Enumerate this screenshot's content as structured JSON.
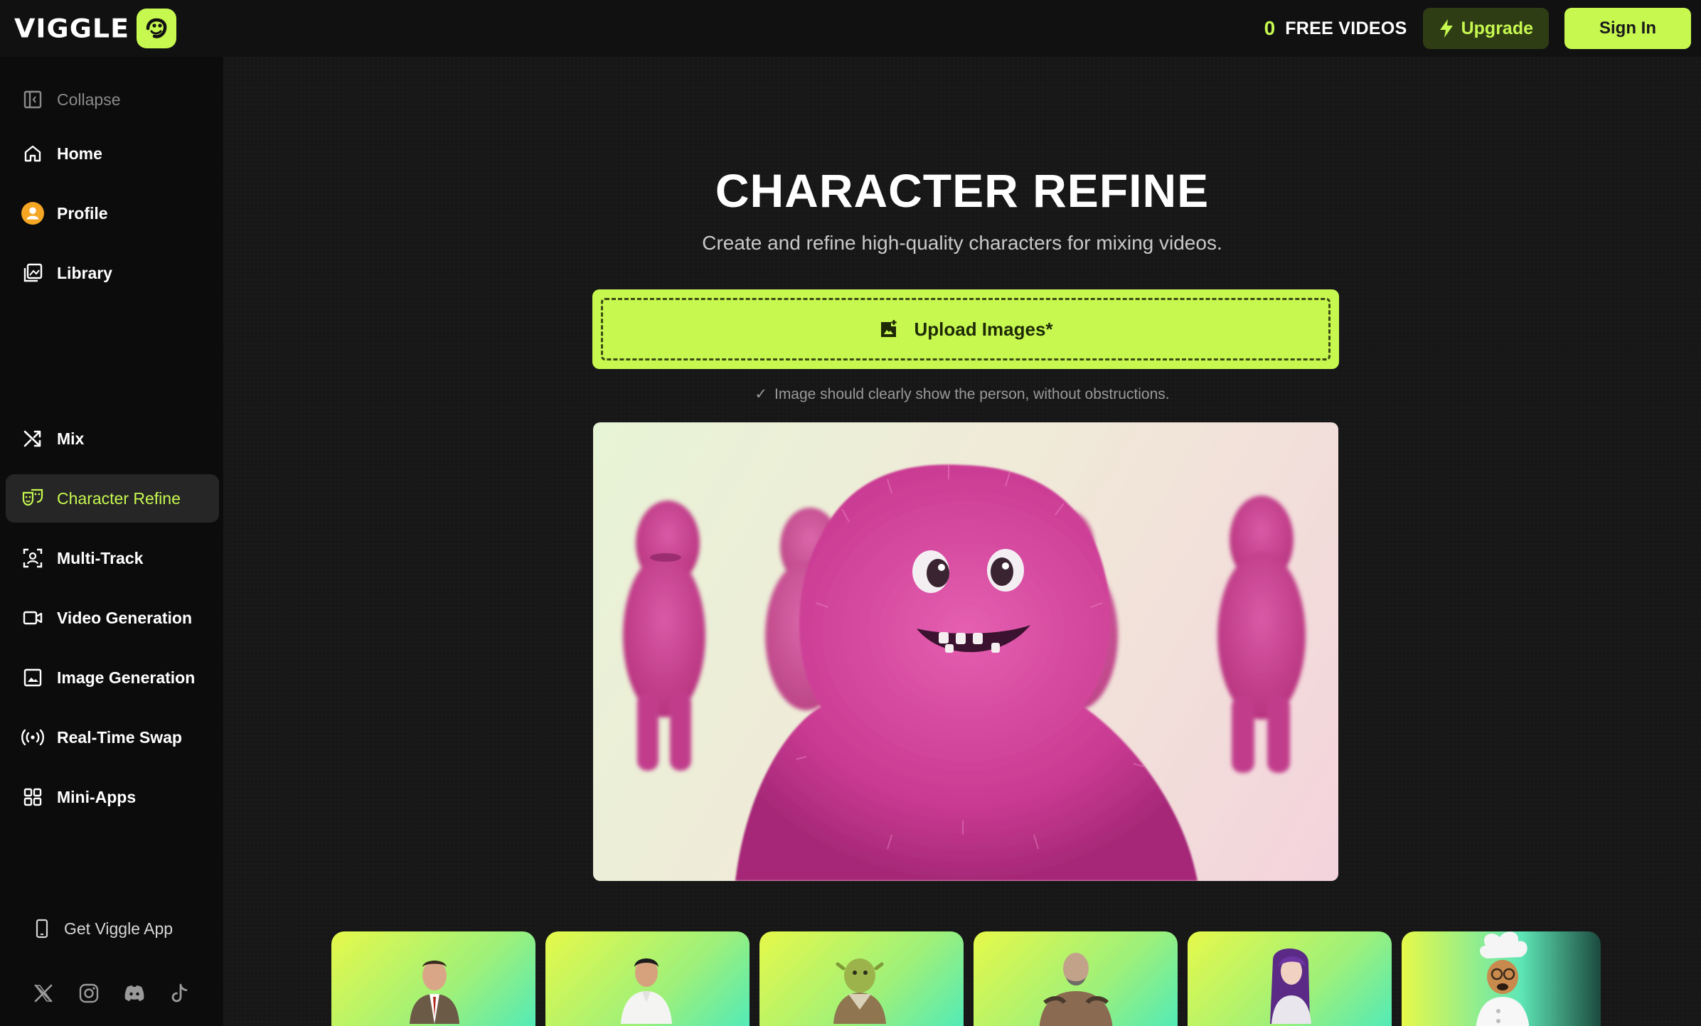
{
  "brand": {
    "name": "VIGGLE"
  },
  "header": {
    "free_count": "0",
    "free_label": "FREE VIDEOS",
    "upgrade_label": "Upgrade",
    "signin_label": "Sign In"
  },
  "sidebar": {
    "collapse_label": "Collapse",
    "top_items": [
      {
        "label": "Home",
        "icon": "home-icon"
      },
      {
        "label": "Profile",
        "icon": "profile-avatar-icon"
      },
      {
        "label": "Library",
        "icon": "library-icon"
      }
    ],
    "tool_items": [
      {
        "label": "Mix",
        "icon": "shuffle-icon"
      },
      {
        "label": "Character Refine",
        "icon": "masks-icon",
        "active": true
      },
      {
        "label": "Multi-Track",
        "icon": "person-frame-icon"
      },
      {
        "label": "Video Generation",
        "icon": "video-camera-icon"
      },
      {
        "label": "Image Generation",
        "icon": "image-icon"
      },
      {
        "label": "Real-Time Swap",
        "icon": "broadcast-icon"
      },
      {
        "label": "Mini-Apps",
        "icon": "grid-icon"
      }
    ],
    "get_app_label": "Get Viggle App",
    "socials": [
      "x-icon",
      "instagram-icon",
      "discord-icon",
      "tiktok-icon"
    ]
  },
  "main": {
    "title": "CHARACTER REFINE",
    "subtitle": "Create and refine high-quality characters for mixing videos.",
    "upload_label": "Upload Images*",
    "hint": "Image should clearly show the person, without obstructions."
  },
  "colors": {
    "accent": "#c6f850",
    "background": "#171717",
    "sidebar": "#0c0c0c"
  }
}
